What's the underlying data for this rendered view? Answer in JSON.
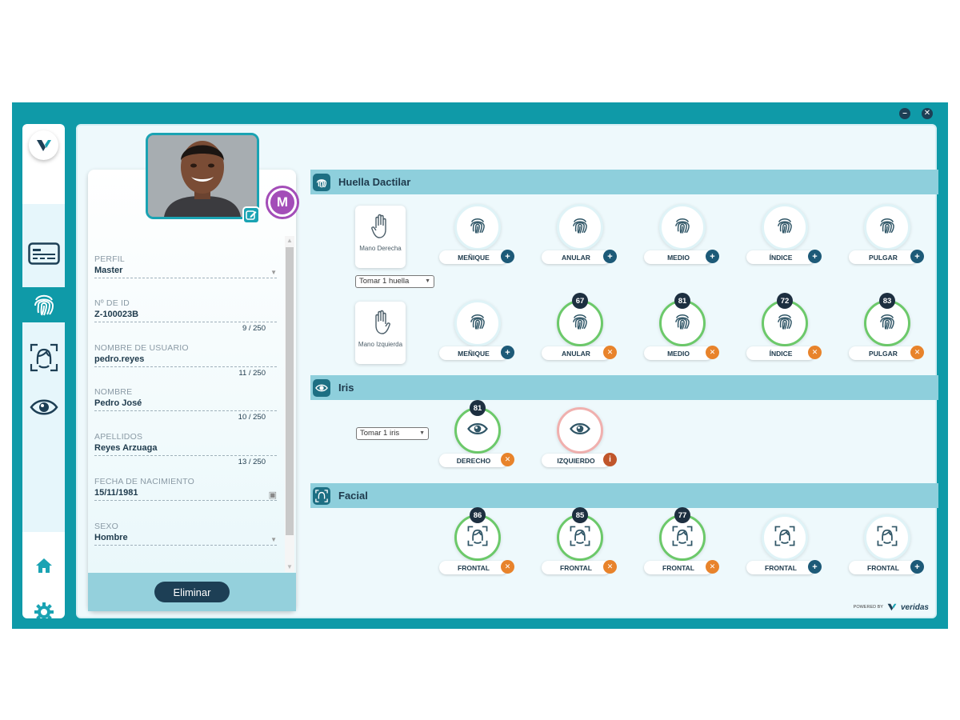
{
  "window": {
    "minimize_label": "–",
    "close_label": "✕"
  },
  "sidebar": {
    "logo_letter": "V",
    "items": [
      {
        "name": "id-card-icon"
      },
      {
        "name": "fingerprint-icon",
        "active": true
      },
      {
        "name": "face-scan-icon"
      },
      {
        "name": "eye-icon"
      }
    ]
  },
  "profile": {
    "badge": "M",
    "fields": [
      {
        "label": "PERFIL",
        "value": "Master",
        "kind": "select",
        "count": ""
      },
      {
        "label": "Nº DE ID",
        "value": "Z-100023B",
        "kind": "text",
        "count": "9 / 250"
      },
      {
        "label": "NOMBRE DE USUARIO",
        "value": "pedro.reyes",
        "kind": "text",
        "count": "11 / 250"
      },
      {
        "label": "NOMBRE",
        "value": "Pedro José",
        "kind": "text",
        "count": "10 / 250"
      },
      {
        "label": "APELLIDOS",
        "value": "Reyes Arzuaga",
        "kind": "text",
        "count": "13 / 250"
      },
      {
        "label": "FECHA DE NACIMIENTO",
        "value": "15/11/1981",
        "kind": "date",
        "count": ""
      },
      {
        "label": "SEXO",
        "value": "Hombre",
        "kind": "select",
        "count": ""
      }
    ],
    "delete_label": "Eliminar"
  },
  "fingerprint": {
    "title": "Huella Dactilar",
    "right_hand_label": "Mano Derecha",
    "left_hand_label": "Mano Izquierda",
    "capture_select": "Tomar 1 huella",
    "right": [
      {
        "label": "MEÑIQUE",
        "score": "",
        "state": "add"
      },
      {
        "label": "ANULAR",
        "score": "",
        "state": "add"
      },
      {
        "label": "MEDIO",
        "score": "",
        "state": "add"
      },
      {
        "label": "ÍNDICE",
        "score": "",
        "state": "add"
      },
      {
        "label": "PULGAR",
        "score": "",
        "state": "add"
      }
    ],
    "left": [
      {
        "label": "MEÑIQUE",
        "score": "",
        "state": "add"
      },
      {
        "label": "ANULAR",
        "score": "67",
        "state": "remove"
      },
      {
        "label": "MEDIO",
        "score": "81",
        "state": "remove"
      },
      {
        "label": "ÍNDICE",
        "score": "72",
        "state": "remove"
      },
      {
        "label": "PULGAR",
        "score": "83",
        "state": "remove"
      }
    ]
  },
  "iris": {
    "title": "Iris",
    "capture_select": "Tomar 1 iris",
    "items": [
      {
        "label": "DERECHO",
        "score": "81",
        "state": "remove"
      },
      {
        "label": "IZQUIERDO",
        "score": "",
        "state": "info"
      }
    ]
  },
  "facial": {
    "title": "Facial",
    "items": [
      {
        "label": "FRONTAL",
        "score": "86",
        "state": "remove"
      },
      {
        "label": "FRONTAL",
        "score": "85",
        "state": "remove"
      },
      {
        "label": "FRONTAL",
        "score": "77",
        "state": "remove"
      },
      {
        "label": "FRONTAL",
        "score": "",
        "state": "add"
      },
      {
        "label": "FRONTAL",
        "score": "",
        "state": "add"
      }
    ]
  },
  "footer": {
    "powered_by": "POWERED BY",
    "brand": "veridas"
  },
  "colors": {
    "teal": "#0f9aa8",
    "navy": "#1d3f55",
    "green": "#6cc96a",
    "orange": "#e8832b",
    "purple": "#a34db8"
  }
}
